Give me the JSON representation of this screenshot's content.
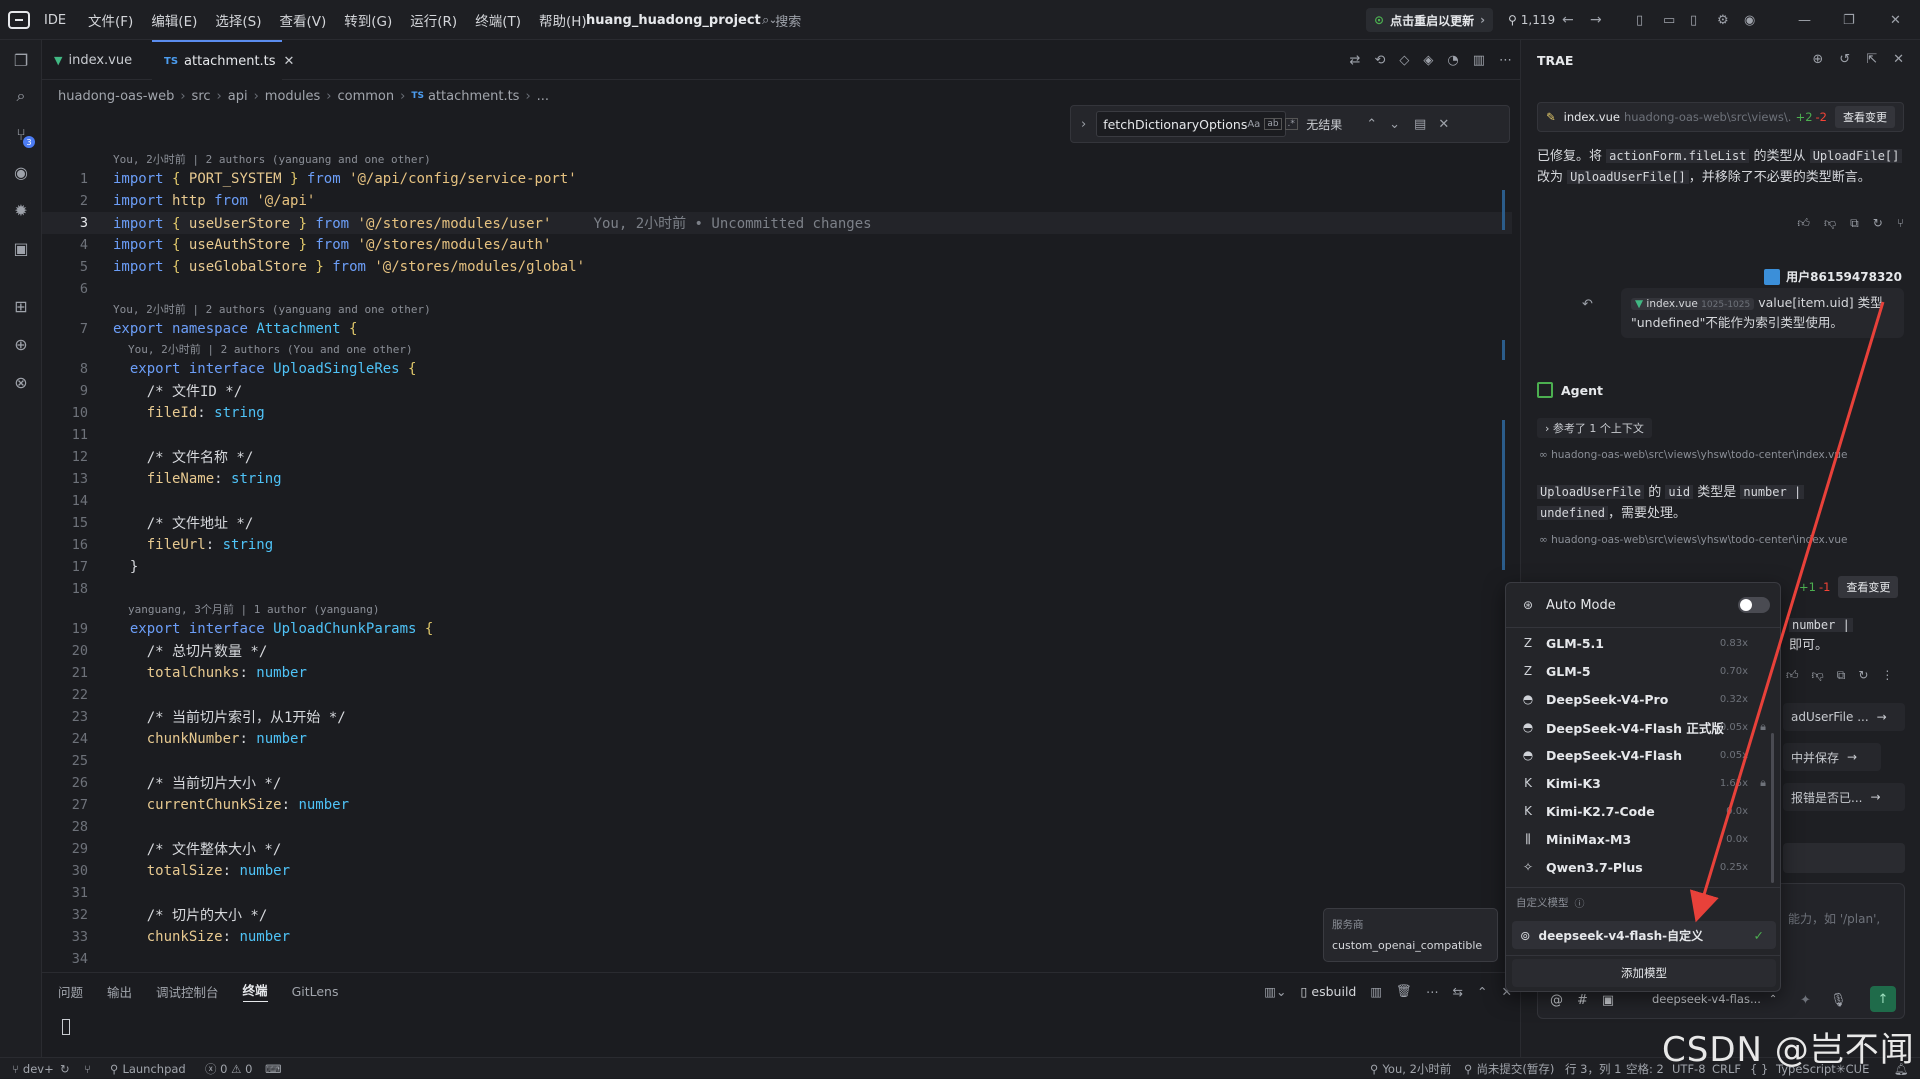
{
  "titlebar": {
    "app_label": "IDE",
    "menus": [
      "文件(F)",
      "编辑(E)",
      "选择(S)",
      "查看(V)",
      "转到(G)",
      "运行(R)",
      "终端(T)",
      "帮助(H)"
    ],
    "project": "huang_huadong_project",
    "search": "搜索",
    "update_label": "点击重启以更新",
    "commit_count": "1,119"
  },
  "tabs": [
    {
      "label": "index.vue",
      "icon": "vue-icon"
    },
    {
      "label": "attachment.ts",
      "icon": "ts-icon",
      "prefix": "TS"
    }
  ],
  "breadcrumb": [
    "huadong-oas-web",
    "src",
    "api",
    "modules",
    "common",
    "attachment.ts",
    "..."
  ],
  "breadcrumb_ts": "TS",
  "find": {
    "query": "fetchDictionaryOptions",
    "aa": "Aa",
    "result": "无结果"
  },
  "blames": [
    "You, 2小时前 | 2 authors (yanguang and one other)",
    "You, 2小时前 | 2 authors (yanguang and one other)",
    "You, 2小时前 | 2 authors (You and one other)",
    "yanguang, 3个月前 | 1 author (yanguang)"
  ],
  "inline_blame": "You, 2小时前 • Uncommitted changes",
  "code_lines": [
    {
      "n": "1",
      "t": "import { PORT_SYSTEM } from '@/api/config/service-port'"
    },
    {
      "n": "2",
      "t": "import http from '@/api'"
    },
    {
      "n": "3",
      "t": "import { useUserStore } from '@/stores/modules/user'"
    },
    {
      "n": "4",
      "t": "import { useAuthStore } from '@/stores/modules/auth'"
    },
    {
      "n": "5",
      "t": "import { useGlobalStore } from '@/stores/modules/global'"
    },
    {
      "n": "6",
      "t": ""
    },
    {
      "n": "7",
      "t": "export namespace Attachment {"
    },
    {
      "n": "8",
      "t": "  export interface UploadSingleRes {"
    },
    {
      "n": "9",
      "t": "    /* 文件ID */"
    },
    {
      "n": "10",
      "t": "    fileId: string"
    },
    {
      "n": "11",
      "t": ""
    },
    {
      "n": "12",
      "t": "    /* 文件名称 */"
    },
    {
      "n": "13",
      "t": "    fileName: string"
    },
    {
      "n": "14",
      "t": ""
    },
    {
      "n": "15",
      "t": "    /* 文件地址 */"
    },
    {
      "n": "16",
      "t": "    fileUrl: string"
    },
    {
      "n": "17",
      "t": "  }"
    },
    {
      "n": "18",
      "t": ""
    },
    {
      "n": "19",
      "t": "  export interface UploadChunkParams {"
    },
    {
      "n": "20",
      "t": "    /* 总切片数量 */"
    },
    {
      "n": "21",
      "t": "    totalChunks: number"
    },
    {
      "n": "22",
      "t": ""
    },
    {
      "n": "23",
      "t": "    /* 当前切片索引，从1开始 */"
    },
    {
      "n": "24",
      "t": "    chunkNumber: number"
    },
    {
      "n": "25",
      "t": ""
    },
    {
      "n": "26",
      "t": "    /* 当前切片大小 */"
    },
    {
      "n": "27",
      "t": "    currentChunkSize: number"
    },
    {
      "n": "28",
      "t": ""
    },
    {
      "n": "29",
      "t": "    /* 文件整体大小 */"
    },
    {
      "n": "30",
      "t": "    totalSize: number"
    },
    {
      "n": "31",
      "t": ""
    },
    {
      "n": "32",
      "t": "    /* 切片的大小 */"
    },
    {
      "n": "33",
      "t": "    chunkSize: number"
    },
    {
      "n": "34",
      "t": ""
    }
  ],
  "panel": {
    "tabs": [
      "问题",
      "输出",
      "调试控制台",
      "终端",
      "GitLens"
    ],
    "active_tab": "终端",
    "terminal_name": "esbuild"
  },
  "statusbar": {
    "branch": "dev+",
    "launchpad": "Launchpad",
    "errors": "0",
    "warnings": "0",
    "blame": "You, 2小时前",
    "uncommitted": "尚未提交(暂存)",
    "position": "行 3，列 1",
    "spaces": "空格: 2",
    "encoding": "UTF-8",
    "eol": "CRLF",
    "braces": "{ }",
    "language": "TypeScript",
    "cue": "CUE"
  },
  "chat": {
    "title": "TRAE",
    "file_chip": {
      "name": "index.vue",
      "path": "huadong-oas-web\\src\\views\\...",
      "add": "+2",
      "del": "-2",
      "btn": "查看变更"
    },
    "reply1": {
      "pre": "已修复。将 ",
      "code1": "actionForm.fileList",
      "mid1": " 的类型从 ",
      "code2": "UploadFile[]",
      "mid2": " 改为 ",
      "code3": "UploadUserFile[]",
      "post": "，并移除了不必要的类型断言。"
    },
    "user_name": "用户86159478320",
    "user_msg": {
      "file": "index.vue",
      "range": "1025-1025",
      "line1": "value[item.uid] 类型",
      "line2": "\"undefined\"不能作为索引类型使用。"
    },
    "agent_label": "Agent",
    "context_label": "参考了 1 个上下文",
    "file_ref1": "huadong-oas-web\\src\\views\\yhsw\\todo-center\\index.vue",
    "reply2": {
      "code1": "UploadUserFile",
      "mid1": " 的 ",
      "code2": "uid",
      "mid2": " 类型是 ",
      "code3": "number |",
      "code4": "undefined",
      "post": "，需要处理。"
    },
    "file_ref2": "huadong-oas-web\\src\\views\\yhsw\\todo-center\\index.vue",
    "diff2": {
      "add": "+1",
      "del": "-1",
      "btn": "查看变更"
    },
    "partial_code": "number |",
    "partial_text": "即可。",
    "sugg1": "adUserFile ...",
    "sugg2": "中并保存",
    "sugg3": "报错是否已...",
    "input_hint": "能力，如 '/plan',",
    "model_selector": "deepseek-v4-flas..."
  },
  "dropdown": {
    "auto_mode": "Auto Mode",
    "models": [
      {
        "name": "GLM-5.1",
        "ratio": "0.83x",
        "icon": "zhipu-icon"
      },
      {
        "name": "GLM-5",
        "ratio": "0.70x",
        "icon": "zhipu-icon"
      },
      {
        "name": "DeepSeek-V4-Pro",
        "ratio": "0.32x",
        "icon": "deepseek-icon"
      },
      {
        "name": "DeepSeek-V4-Flash 正式版",
        "ratio": "0.05x",
        "icon": "deepseek-icon"
      },
      {
        "name": "DeepSeek-V4-Flash",
        "ratio": "0.05x",
        "icon": "deepseek-icon"
      },
      {
        "name": "Kimi-K3",
        "ratio": "1.65x",
        "icon": "kimi-icon"
      },
      {
        "name": "Kimi-K2.7-Code",
        "ratio": "0.0x",
        "icon": "kimi-icon"
      },
      {
        "name": "MiniMax-M3",
        "ratio": "0.0x",
        "icon": "minimax-icon"
      },
      {
        "name": "Qwen3.7-Plus",
        "ratio": "0.25x",
        "icon": "qwen-icon"
      }
    ],
    "custom_header": "自定义模型",
    "custom_model": "deepseek-v4-flash-自定义",
    "add_model": "添加模型"
  },
  "tooltip": {
    "title": "服务商",
    "value": "custom_openai_compatible"
  },
  "watermark": "CSDN @岂不闻",
  "colors": {
    "accent": "#5b8def",
    "keyword": "#6c9ef8",
    "string": "#e6c280",
    "type": "#4fc3f7",
    "annotation_arrow": "#e8413a",
    "add": "#4caf50",
    "del": "#f44336"
  }
}
